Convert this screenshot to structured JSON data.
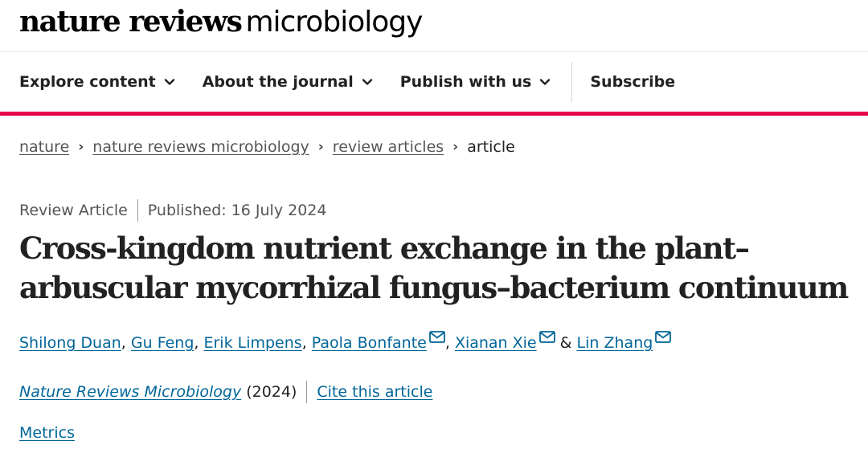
{
  "header": {
    "logo_bold": "nature reviews",
    "logo_light": "microbiology"
  },
  "nav": {
    "items": [
      {
        "label": "Explore content"
      },
      {
        "label": "About the journal"
      },
      {
        "label": "Publish with us"
      }
    ],
    "subscribe": "Subscribe"
  },
  "accent_color": "#e5004b",
  "link_color": "#006699",
  "breadcrumb": {
    "items": [
      "nature",
      "nature reviews microbiology",
      "review articles"
    ],
    "current": "article"
  },
  "article": {
    "type": "Review Article",
    "published": "Published: 16 July 2024",
    "title": "Cross-kingdom nutrient exchange in the plant–arbuscular mycorrhizal fungus–bacterium continuum",
    "authors": [
      {
        "name": "Shilong Duan",
        "sep": ", ",
        "mail": false
      },
      {
        "name": "Gu Feng",
        "sep": ", ",
        "mail": false
      },
      {
        "name": "Erik Limpens",
        "sep": ", ",
        "mail": false
      },
      {
        "name": "Paola Bonfante",
        "sep": ", ",
        "mail": true
      },
      {
        "name": "Xianan Xie",
        "sep": " & ",
        "mail": true
      },
      {
        "name": "Lin Zhang",
        "sep": "",
        "mail": true
      }
    ],
    "journal": "Nature Reviews Microbiology",
    "year": "(2024)",
    "cite": "Cite this article",
    "metrics": "Metrics"
  }
}
